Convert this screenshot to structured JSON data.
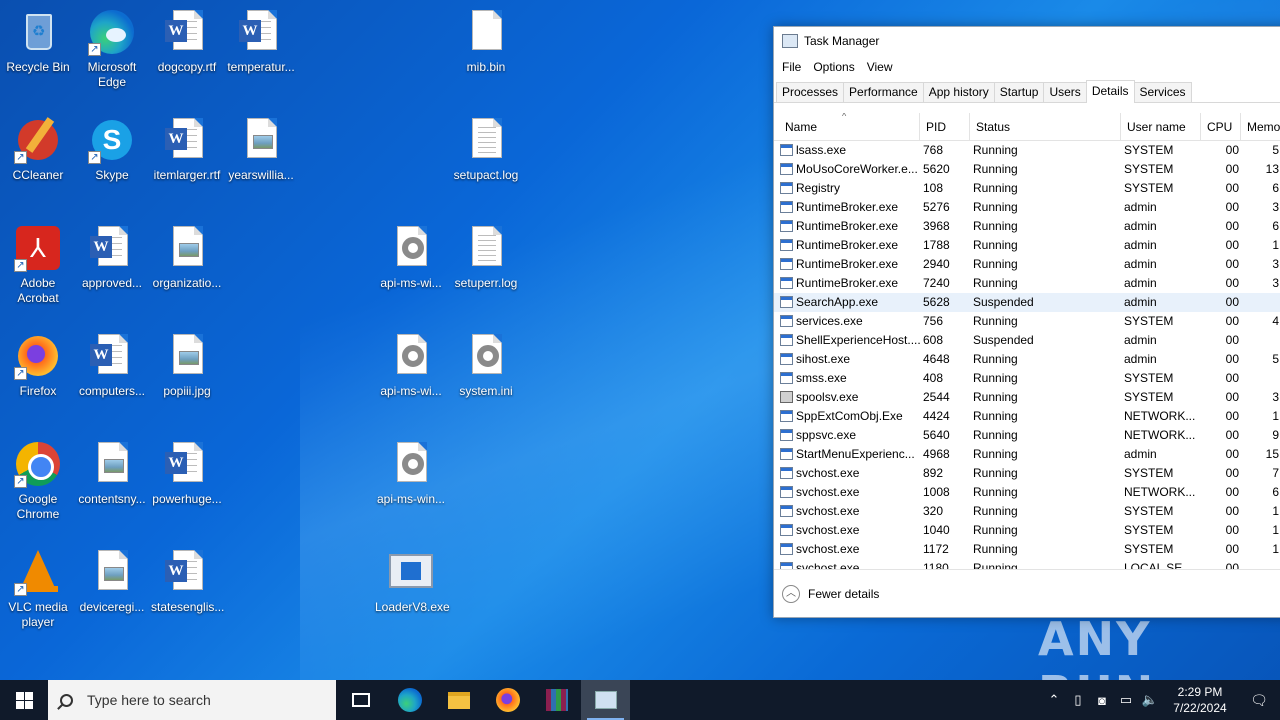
{
  "desktop_icons": [
    {
      "label": "Recycle Bin"
    },
    {
      "label": "Microsoft Edge"
    },
    {
      "label": "dogcopy.rtf"
    },
    {
      "label": "temperatur..."
    },
    {
      "label": "mib.bin"
    },
    {
      "label": "CCleaner"
    },
    {
      "label": "Skype"
    },
    {
      "label": "itemlarger.rtf"
    },
    {
      "label": "yearswillia..."
    },
    {
      "label": "setupact.log"
    },
    {
      "label": "Adobe Acrobat"
    },
    {
      "label": "approved..."
    },
    {
      "label": "organizatio..."
    },
    {
      "label": "api-ms-wi..."
    },
    {
      "label": "setuperr.log"
    },
    {
      "label": "Firefox"
    },
    {
      "label": "computers..."
    },
    {
      "label": "popiii.jpg"
    },
    {
      "label": "api-ms-wi..."
    },
    {
      "label": "system.ini"
    },
    {
      "label": "Google Chrome"
    },
    {
      "label": "contentsny..."
    },
    {
      "label": "powerhuge..."
    },
    {
      "label": "api-ms-win..."
    },
    {
      "label": "VLC media player"
    },
    {
      "label": "deviceregi..."
    },
    {
      "label": "statesenglis..."
    },
    {
      "label": "LoaderV8.exe"
    }
  ],
  "task_manager": {
    "title": "Task Manager",
    "menu": [
      "File",
      "Options",
      "View"
    ],
    "tabs": [
      "Processes",
      "Performance",
      "App history",
      "Startup",
      "Users",
      "Details",
      "Services"
    ],
    "active_tab": "Details",
    "columns": [
      "Name",
      "PID",
      "Status",
      "User name",
      "CPU",
      "Memo"
    ],
    "rows": [
      {
        "name": "lsass.exe",
        "pid": "768",
        "status": "Running",
        "user": "SYSTEM",
        "cpu": "00",
        "mem": "5"
      },
      {
        "name": "MoUsoCoreWorker.e...",
        "pid": "5620",
        "status": "Running",
        "user": "SYSTEM",
        "cpu": "00",
        "mem": "13"
      },
      {
        "name": "Registry",
        "pid": "108",
        "status": "Running",
        "user": "SYSTEM",
        "cpu": "00",
        "mem": "6"
      },
      {
        "name": "RuntimeBroker.exe",
        "pid": "5276",
        "status": "Running",
        "user": "admin",
        "cpu": "00",
        "mem": "3"
      },
      {
        "name": "RuntimeBroker.exe",
        "pid": "3968",
        "status": "Running",
        "user": "admin",
        "cpu": "00",
        "mem": "6"
      },
      {
        "name": "RuntimeBroker.exe",
        "pid": "1788",
        "status": "Running",
        "user": "admin",
        "cpu": "00",
        "mem": "1"
      },
      {
        "name": "RuntimeBroker.exe",
        "pid": "2940",
        "status": "Running",
        "user": "admin",
        "cpu": "00",
        "mem": "3"
      },
      {
        "name": "RuntimeBroker.exe",
        "pid": "7240",
        "status": "Running",
        "user": "admin",
        "cpu": "00",
        "mem": "3"
      },
      {
        "name": "SearchApp.exe",
        "pid": "5628",
        "status": "Suspended",
        "user": "admin",
        "cpu": "00",
        "mem": ""
      },
      {
        "name": "services.exe",
        "pid": "756",
        "status": "Running",
        "user": "SYSTEM",
        "cpu": "00",
        "mem": "4"
      },
      {
        "name": "ShellExperienceHost....",
        "pid": "608",
        "status": "Suspended",
        "user": "admin",
        "cpu": "00",
        "mem": ""
      },
      {
        "name": "sihost.exe",
        "pid": "4648",
        "status": "Running",
        "user": "admin",
        "cpu": "00",
        "mem": "5"
      },
      {
        "name": "smss.exe",
        "pid": "408",
        "status": "Running",
        "user": "SYSTEM",
        "cpu": "00",
        "mem": ""
      },
      {
        "name": "spoolsv.exe",
        "pid": "2544",
        "status": "Running",
        "user": "SYSTEM",
        "cpu": "00",
        "mem": "3"
      },
      {
        "name": "SppExtComObj.Exe",
        "pid": "4424",
        "status": "Running",
        "user": "NETWORK...",
        "cpu": "00",
        "mem": "1"
      },
      {
        "name": "sppsvc.exe",
        "pid": "5640",
        "status": "Running",
        "user": "NETWORK...",
        "cpu": "00",
        "mem": "9"
      },
      {
        "name": "StartMenuExperienc...",
        "pid": "4968",
        "status": "Running",
        "user": "admin",
        "cpu": "00",
        "mem": "15"
      },
      {
        "name": "svchost.exe",
        "pid": "892",
        "status": "Running",
        "user": "SYSTEM",
        "cpu": "00",
        "mem": "7"
      },
      {
        "name": "svchost.exe",
        "pid": "1008",
        "status": "Running",
        "user": "NETWORK...",
        "cpu": "00",
        "mem": "6"
      },
      {
        "name": "svchost.exe",
        "pid": "320",
        "status": "Running",
        "user": "SYSTEM",
        "cpu": "00",
        "mem": "1"
      },
      {
        "name": "svchost.exe",
        "pid": "1040",
        "status": "Running",
        "user": "SYSTEM",
        "cpu": "00",
        "mem": "1"
      },
      {
        "name": "svchost.exe",
        "pid": "1172",
        "status": "Running",
        "user": "SYSTEM",
        "cpu": "00",
        "mem": "1"
      },
      {
        "name": "svchost.exe",
        "pid": "1180",
        "status": "Running",
        "user": "LOCAL SE...",
        "cpu": "00",
        "mem": ""
      }
    ],
    "fewer_details": "Fewer details"
  },
  "watermark": "ANY RUN",
  "taskbar": {
    "search_placeholder": "Type here to search",
    "time": "2:29 PM",
    "date": "7/22/2024"
  }
}
